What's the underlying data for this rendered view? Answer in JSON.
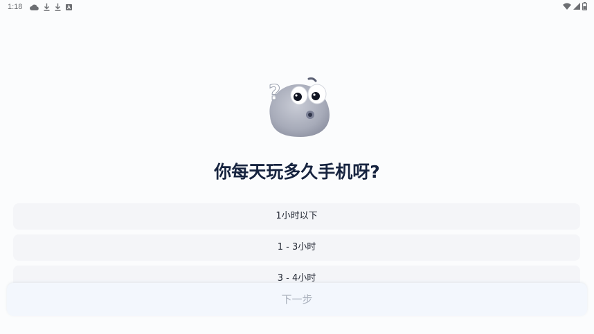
{
  "status_bar": {
    "time": "1:18",
    "left_icons": [
      "cloud-icon",
      "download-icon",
      "download-icon",
      "accessibility-a-icon"
    ],
    "right_icons": [
      "wifi-icon",
      "cell-signal-icon",
      "battery-icon"
    ]
  },
  "question": {
    "title": "你每天玩多久手机呀?"
  },
  "options": [
    {
      "label": "1小时以下"
    },
    {
      "label": "1 - 3小时"
    },
    {
      "label": "3 - 4小时"
    }
  ],
  "next_button": {
    "label": "下一步",
    "state": "disabled"
  },
  "colors": {
    "title": "#16233f",
    "option_bg": "#f4f5f8",
    "button_bg": "#f3f7fd",
    "button_text_disabled": "#a9b0bc"
  }
}
